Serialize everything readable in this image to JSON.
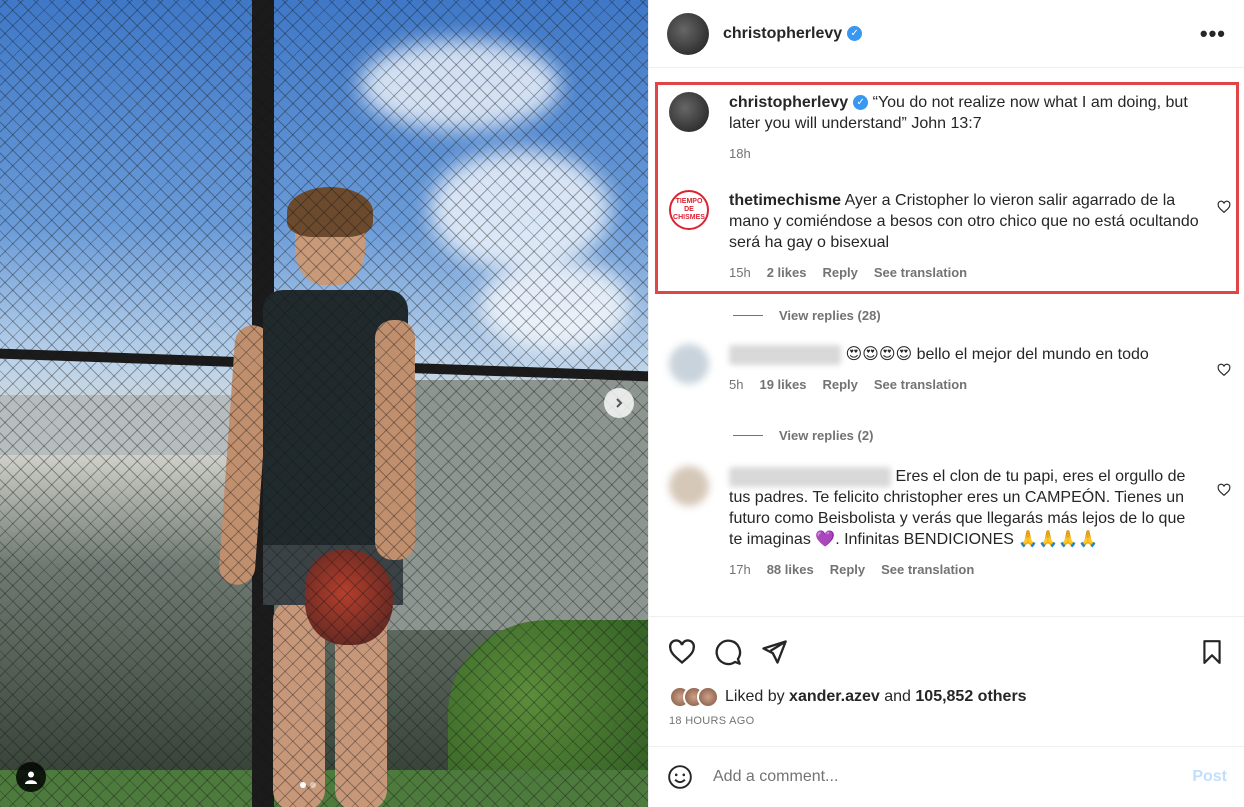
{
  "header": {
    "username": "christopherlevy",
    "verified_badge": "✓",
    "more_label": "•••"
  },
  "caption": {
    "username": "christopherlevy",
    "text": "“You do not realize now what I am doing, but later you will understand” John 13:7",
    "time": "18h"
  },
  "comments": [
    {
      "username": "thetimechisme",
      "avatar_text": "TIEMPO DE CHISMES",
      "text": "Ayer a Cristopher lo vieron salir agarrado de la mano y comiéndose a besos con otro chico que no está ocultando será ha gay o bisexual",
      "time": "15h",
      "likes": "2 likes",
      "reply": "Reply",
      "translate": "See translation"
    },
    {
      "text": "😍😍😍😍 bello el mejor del mundo en todo",
      "time": "5h",
      "likes": "19 likes",
      "reply": "Reply",
      "translate": "See translation"
    },
    {
      "text": "Eres el clon de tu papi, eres el orgullo de tus padres. Te felicito christopher eres un CAMPEÓN. Tienes un futuro como Beisbolista y verás que llegarás más lejos de lo que te imaginas 💜. Infinitas BENDICIONES 🙏🙏🙏🙏",
      "time": "17h",
      "likes": "88 likes",
      "reply": "Reply",
      "translate": "See translation"
    }
  ],
  "view_replies": [
    "View replies (28)",
    "View replies (2)"
  ],
  "liked_by": {
    "prefix": "Liked by",
    "user": "xander.azev",
    "middle": "and",
    "others": "105,852 others"
  },
  "timestamp": "18 HOURS AGO",
  "add_comment": {
    "placeholder": "Add a comment...",
    "post_label": "Post"
  },
  "icons": {
    "like": "heart-icon",
    "comment": "comment-icon",
    "share": "share-icon",
    "save": "bookmark-icon",
    "emoji": "emoji-icon",
    "next": "chevron-right-icon",
    "tag": "user-tag-icon"
  },
  "colors": {
    "highlight": "#e04646",
    "verified": "#3897f0",
    "post_button": "#c0dffd",
    "muted": "#737373"
  }
}
